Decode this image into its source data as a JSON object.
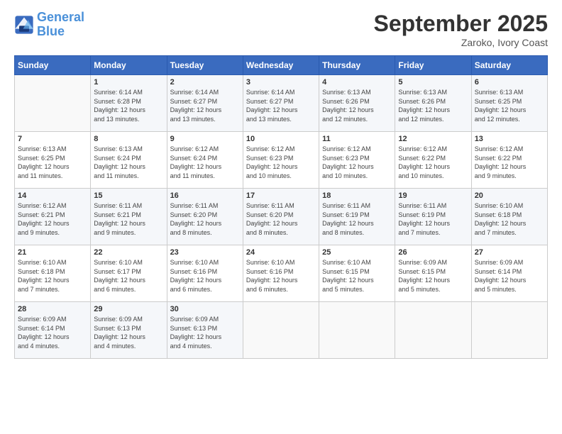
{
  "header": {
    "logo_line1": "General",
    "logo_line2": "Blue",
    "month_title": "September 2025",
    "location": "Zaroko, Ivory Coast"
  },
  "weekdays": [
    "Sunday",
    "Monday",
    "Tuesday",
    "Wednesday",
    "Thursday",
    "Friday",
    "Saturday"
  ],
  "weeks": [
    [
      {
        "day": "",
        "sunrise": "",
        "sunset": "",
        "daylight": ""
      },
      {
        "day": "1",
        "sunrise": "Sunrise: 6:14 AM",
        "sunset": "Sunset: 6:28 PM",
        "daylight": "Daylight: 12 hours and 13 minutes."
      },
      {
        "day": "2",
        "sunrise": "Sunrise: 6:14 AM",
        "sunset": "Sunset: 6:27 PM",
        "daylight": "Daylight: 12 hours and 13 minutes."
      },
      {
        "day": "3",
        "sunrise": "Sunrise: 6:14 AM",
        "sunset": "Sunset: 6:27 PM",
        "daylight": "Daylight: 12 hours and 13 minutes."
      },
      {
        "day": "4",
        "sunrise": "Sunrise: 6:13 AM",
        "sunset": "Sunset: 6:26 PM",
        "daylight": "Daylight: 12 hours and 12 minutes."
      },
      {
        "day": "5",
        "sunrise": "Sunrise: 6:13 AM",
        "sunset": "Sunset: 6:26 PM",
        "daylight": "Daylight: 12 hours and 12 minutes."
      },
      {
        "day": "6",
        "sunrise": "Sunrise: 6:13 AM",
        "sunset": "Sunset: 6:25 PM",
        "daylight": "Daylight: 12 hours and 12 minutes."
      }
    ],
    [
      {
        "day": "7",
        "sunrise": "Sunrise: 6:13 AM",
        "sunset": "Sunset: 6:25 PM",
        "daylight": "Daylight: 12 hours and 11 minutes."
      },
      {
        "day": "8",
        "sunrise": "Sunrise: 6:13 AM",
        "sunset": "Sunset: 6:24 PM",
        "daylight": "Daylight: 12 hours and 11 minutes."
      },
      {
        "day": "9",
        "sunrise": "Sunrise: 6:12 AM",
        "sunset": "Sunset: 6:24 PM",
        "daylight": "Daylight: 12 hours and 11 minutes."
      },
      {
        "day": "10",
        "sunrise": "Sunrise: 6:12 AM",
        "sunset": "Sunset: 6:23 PM",
        "daylight": "Daylight: 12 hours and 10 minutes."
      },
      {
        "day": "11",
        "sunrise": "Sunrise: 6:12 AM",
        "sunset": "Sunset: 6:23 PM",
        "daylight": "Daylight: 12 hours and 10 minutes."
      },
      {
        "day": "12",
        "sunrise": "Sunrise: 6:12 AM",
        "sunset": "Sunset: 6:22 PM",
        "daylight": "Daylight: 12 hours and 10 minutes."
      },
      {
        "day": "13",
        "sunrise": "Sunrise: 6:12 AM",
        "sunset": "Sunset: 6:22 PM",
        "daylight": "Daylight: 12 hours and 9 minutes."
      }
    ],
    [
      {
        "day": "14",
        "sunrise": "Sunrise: 6:12 AM",
        "sunset": "Sunset: 6:21 PM",
        "daylight": "Daylight: 12 hours and 9 minutes."
      },
      {
        "day": "15",
        "sunrise": "Sunrise: 6:11 AM",
        "sunset": "Sunset: 6:21 PM",
        "daylight": "Daylight: 12 hours and 9 minutes."
      },
      {
        "day": "16",
        "sunrise": "Sunrise: 6:11 AM",
        "sunset": "Sunset: 6:20 PM",
        "daylight": "Daylight: 12 hours and 8 minutes."
      },
      {
        "day": "17",
        "sunrise": "Sunrise: 6:11 AM",
        "sunset": "Sunset: 6:20 PM",
        "daylight": "Daylight: 12 hours and 8 minutes."
      },
      {
        "day": "18",
        "sunrise": "Sunrise: 6:11 AM",
        "sunset": "Sunset: 6:19 PM",
        "daylight": "Daylight: 12 hours and 8 minutes."
      },
      {
        "day": "19",
        "sunrise": "Sunrise: 6:11 AM",
        "sunset": "Sunset: 6:19 PM",
        "daylight": "Daylight: 12 hours and 7 minutes."
      },
      {
        "day": "20",
        "sunrise": "Sunrise: 6:10 AM",
        "sunset": "Sunset: 6:18 PM",
        "daylight": "Daylight: 12 hours and 7 minutes."
      }
    ],
    [
      {
        "day": "21",
        "sunrise": "Sunrise: 6:10 AM",
        "sunset": "Sunset: 6:18 PM",
        "daylight": "Daylight: 12 hours and 7 minutes."
      },
      {
        "day": "22",
        "sunrise": "Sunrise: 6:10 AM",
        "sunset": "Sunset: 6:17 PM",
        "daylight": "Daylight: 12 hours and 6 minutes."
      },
      {
        "day": "23",
        "sunrise": "Sunrise: 6:10 AM",
        "sunset": "Sunset: 6:16 PM",
        "daylight": "Daylight: 12 hours and 6 minutes."
      },
      {
        "day": "24",
        "sunrise": "Sunrise: 6:10 AM",
        "sunset": "Sunset: 6:16 PM",
        "daylight": "Daylight: 12 hours and 6 minutes."
      },
      {
        "day": "25",
        "sunrise": "Sunrise: 6:10 AM",
        "sunset": "Sunset: 6:15 PM",
        "daylight": "Daylight: 12 hours and 5 minutes."
      },
      {
        "day": "26",
        "sunrise": "Sunrise: 6:09 AM",
        "sunset": "Sunset: 6:15 PM",
        "daylight": "Daylight: 12 hours and 5 minutes."
      },
      {
        "day": "27",
        "sunrise": "Sunrise: 6:09 AM",
        "sunset": "Sunset: 6:14 PM",
        "daylight": "Daylight: 12 hours and 5 minutes."
      }
    ],
    [
      {
        "day": "28",
        "sunrise": "Sunrise: 6:09 AM",
        "sunset": "Sunset: 6:14 PM",
        "daylight": "Daylight: 12 hours and 4 minutes."
      },
      {
        "day": "29",
        "sunrise": "Sunrise: 6:09 AM",
        "sunset": "Sunset: 6:13 PM",
        "daylight": "Daylight: 12 hours and 4 minutes."
      },
      {
        "day": "30",
        "sunrise": "Sunrise: 6:09 AM",
        "sunset": "Sunset: 6:13 PM",
        "daylight": "Daylight: 12 hours and 4 minutes."
      },
      {
        "day": "",
        "sunrise": "",
        "sunset": "",
        "daylight": ""
      },
      {
        "day": "",
        "sunrise": "",
        "sunset": "",
        "daylight": ""
      },
      {
        "day": "",
        "sunrise": "",
        "sunset": "",
        "daylight": ""
      },
      {
        "day": "",
        "sunrise": "",
        "sunset": "",
        "daylight": ""
      }
    ]
  ]
}
